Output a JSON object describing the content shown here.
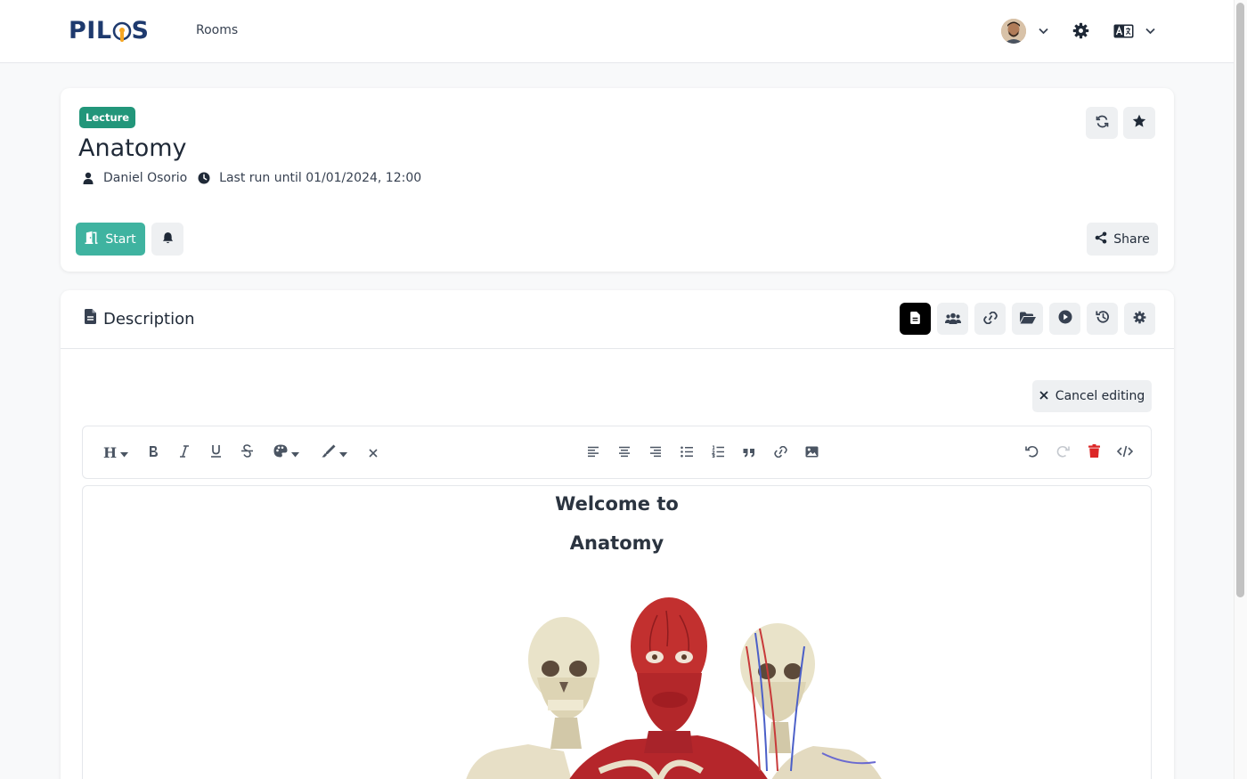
{
  "nav": {
    "logo": "PILOS",
    "rooms_link": "Rooms"
  },
  "room": {
    "type_badge": "Lecture",
    "title": "Anatomy",
    "owner": "Daniel Osorio",
    "last_run": "Last run until 01/01/2024, 12:00",
    "start_label": "Start",
    "share_label": "Share"
  },
  "description": {
    "title": "Description",
    "cancel_label": "Cancel editing",
    "heading_dropdown": "H",
    "content_line1": "Welcome to",
    "content_line2": "Anatomy"
  },
  "colors": {
    "badge": "#22967a",
    "start": "#3fb3a0",
    "delete": "#dc2626",
    "logo": "#1e3a6e",
    "logo_accent": "#f5a623"
  }
}
